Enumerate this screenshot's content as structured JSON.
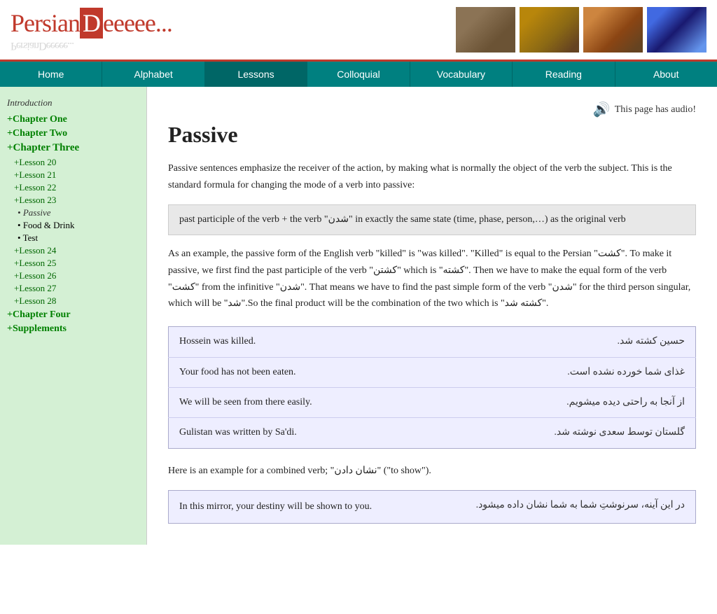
{
  "header": {
    "logo_part1": "Persian",
    "logo_part2": "Deeeee...",
    "logo_reflection": "ısɹǝԀ˥ǝԀ..."
  },
  "nav": {
    "items": [
      {
        "label": "Home",
        "active": false
      },
      {
        "label": "Alphabet",
        "active": false
      },
      {
        "label": "Lessons",
        "active": true
      },
      {
        "label": "Colloquial",
        "active": false
      },
      {
        "label": "Vocabulary",
        "active": false
      },
      {
        "label": "Reading",
        "active": false
      },
      {
        "label": "About",
        "active": false
      }
    ]
  },
  "sidebar": {
    "intro": "Introduction",
    "chapters": [
      {
        "label": "+Chapter One"
      },
      {
        "label": "+Chapter Two"
      },
      {
        "label": "+Chapter Three",
        "bold": true,
        "lessons": [
          {
            "label": "+Lesson 20"
          },
          {
            "label": "+Lesson 21"
          },
          {
            "label": "+Lesson 22"
          },
          {
            "label": "+Lesson 23",
            "sub": [
              {
                "label": "Passive",
                "active": true
              },
              {
                "label": "Food & Drink"
              },
              {
                "label": "Test"
              }
            ]
          },
          {
            "label": "+Lesson 24"
          },
          {
            "label": "+Lesson 25"
          },
          {
            "label": "+Lesson 26"
          },
          {
            "label": "+Lesson 27"
          },
          {
            "label": "+Lesson 28"
          }
        ]
      },
      {
        "label": "+Chapter Four"
      },
      {
        "label": "+Supplements"
      }
    ]
  },
  "content": {
    "audio_label": "This page has audio!",
    "title": "Passive",
    "intro_para": "Passive sentences emphasize the receiver of the action, by making what is normally the object of the verb the subject. This is the standard formula for changing the mode of a verb into passive:",
    "formula": "past participle of the verb + the verb “شدن” in exactly the same state (time, phase, person,…) as the original verb",
    "example_para": "As an example, the passive form of the English verb “killed” is “was killed”. “Killed” is equal to the Persian “کشت”. To make it passive, we first find the past participle of the verb “کشتن” which is “کشته”. Then we have to make the equal form of the verb “کشت” from the infinitive “شدن”. That means we have to find the past simple form of the verb “شدن” for the third person singular, which will be “شد”.So the final product will be the combination of the two which is “کشته شد”.",
    "examples": [
      {
        "english": "Hossein was killed.",
        "persian": "حسین کشته شد."
      },
      {
        "english": "Your food has not been eaten.",
        "persian": "غذای شما خورده نشده است."
      },
      {
        "english": "We will be seen from there easily.",
        "persian": "از آنجا به راحتی دیده میشویم."
      },
      {
        "english": "Gulistan was written by Sa'di.",
        "persian": "گلستان توسط سعدی نوشته شد."
      }
    ],
    "combined_verb_para": "Here is an example for a combined verb; “نشان دادن” (“to show”).",
    "combined_example": {
      "english": "In this mirror, your destiny will be shown to you.",
      "persian": "در این آینه، سرنوشتِ شما به شما نشان داده میشود."
    }
  }
}
